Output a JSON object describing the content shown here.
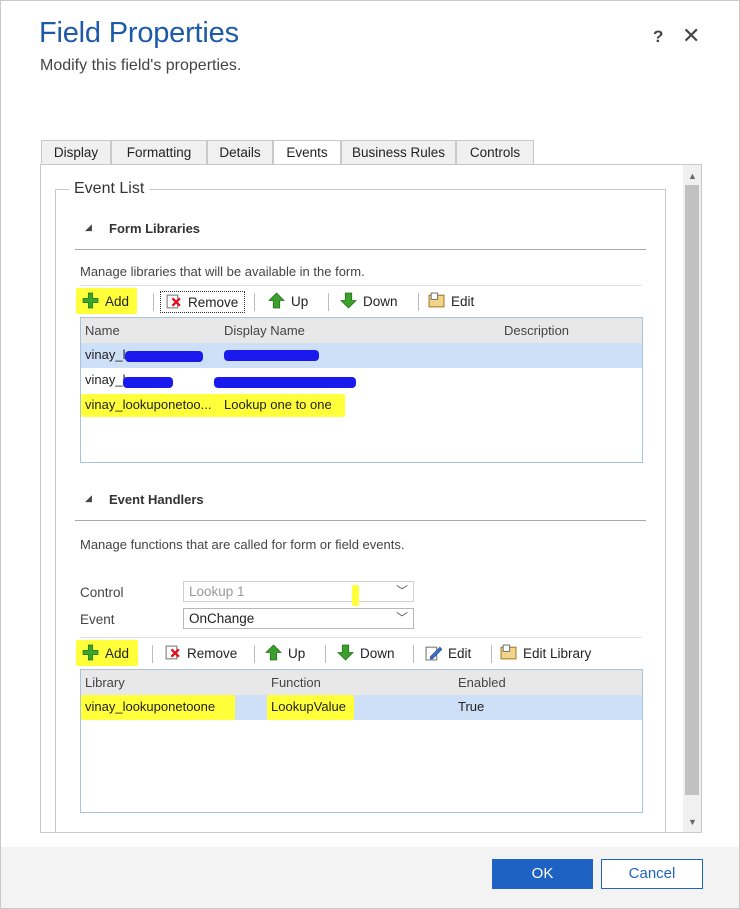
{
  "dialog": {
    "title": "Field Properties",
    "subtitle": "Modify this field's properties.",
    "help": "?",
    "close": "✕"
  },
  "tabs": [
    {
      "label": "Display"
    },
    {
      "label": "Formatting"
    },
    {
      "label": "Details"
    },
    {
      "label": "Events",
      "active": true
    },
    {
      "label": "Business Rules"
    },
    {
      "label": "Controls"
    }
  ],
  "event_list": {
    "legend": "Event List",
    "form_libraries": {
      "header": "Form Libraries",
      "description": "Manage libraries that will be available in the form.",
      "toolbar": {
        "add": "Add",
        "remove": "Remove",
        "up": "Up",
        "down": "Down",
        "edit": "Edit"
      },
      "columns": {
        "name": "Name",
        "display_name": "Display Name",
        "description": "Description"
      },
      "rows": [
        {
          "name": "vinay_l",
          "display_name": "",
          "selected": true
        },
        {
          "name": "vinay_l",
          "display_name": ""
        },
        {
          "name": "vinay_lookuponetoo...",
          "display_name": "Lookup one to one"
        }
      ]
    },
    "event_handlers": {
      "header": "Event Handlers",
      "description": "Manage functions that are called for form or field events.",
      "control_label": "Control",
      "control_value": "Lookup 1",
      "event_label": "Event",
      "event_value": "OnChange",
      "toolbar": {
        "add": "Add",
        "remove": "Remove",
        "up": "Up",
        "down": "Down",
        "edit": "Edit",
        "edit_library": "Edit Library"
      },
      "columns": {
        "library": "Library",
        "function": "Function",
        "enabled": "Enabled"
      },
      "rows": [
        {
          "library": "vinay_lookuponetoone",
          "function": "LookupValue",
          "enabled": "True"
        }
      ]
    }
  },
  "footer": {
    "ok": "OK",
    "cancel": "Cancel"
  },
  "colors": {
    "accent": "#1e63c4",
    "title": "#1e5aa8",
    "highlight": "#ffff3a",
    "redaction": "#1a1aee",
    "selected_row": "#cde0f7"
  }
}
